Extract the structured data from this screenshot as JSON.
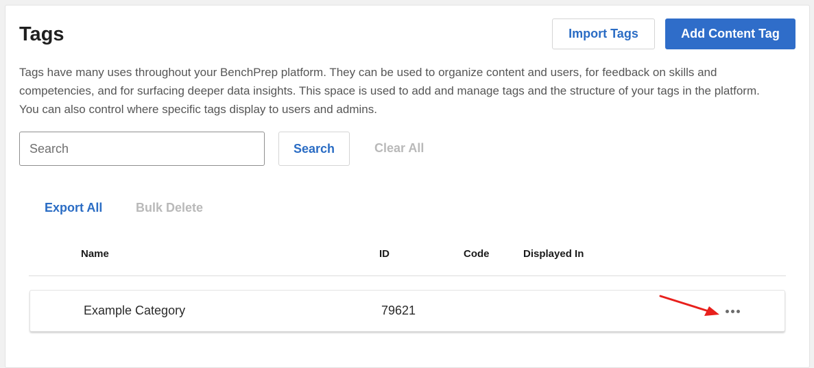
{
  "header": {
    "title": "Tags",
    "import_label": "Import Tags",
    "add_label": "Add Content Tag"
  },
  "description": "Tags have many uses throughout your BenchPrep platform. They can be used to organize content and users, for feedback on skills and competencies, and for surfacing deeper data insights. This space is used to add and manage tags and the structure of your tags in the platform. You can also control where specific tags display to users and admins.",
  "search": {
    "placeholder": "Search",
    "value": "",
    "button_label": "Search",
    "clear_label": "Clear All"
  },
  "actions": {
    "export_label": "Export All",
    "bulk_delete_label": "Bulk Delete"
  },
  "table": {
    "columns": [
      "Name",
      "ID",
      "Code",
      "Displayed In"
    ],
    "rows": [
      {
        "name": "Example Category",
        "id": "79621",
        "code": "",
        "displayed_in": ""
      }
    ]
  },
  "icons": {
    "row_menu": "more-horizontal-icon",
    "annotation": "red-arrow-icon"
  },
  "colors": {
    "accent": "#2f6dc9",
    "link": "#2a6cc4",
    "disabled": "#b9b9b9",
    "annotation": "#e8201c"
  }
}
